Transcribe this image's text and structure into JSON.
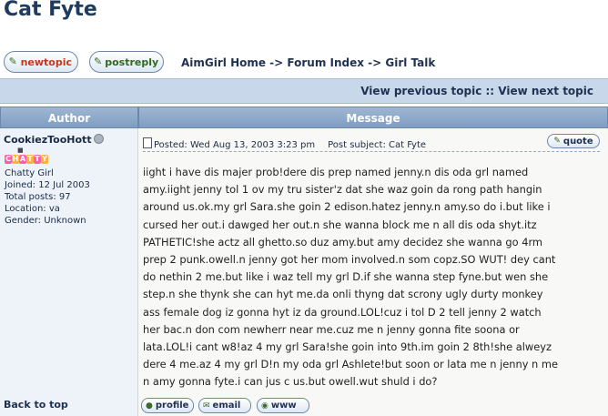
{
  "page": {
    "title": "Cat Fyte"
  },
  "toolbar": {
    "newtopic_label": "newtopic",
    "postreply_label": "postreply"
  },
  "breadcrumb": {
    "text": "AimGirl Home -> Forum Index -> Girl Talk"
  },
  "topic_nav": {
    "text": "View previous topic :: View next topic"
  },
  "table": {
    "author_header": "Author",
    "message_header": "Message"
  },
  "poster": {
    "username": "CookiezTooHott",
    "rank_text": "CHATTY",
    "rank": "Chatty Girl",
    "joined": "Joined: 12 Jul 2003",
    "total_posts": "Total posts: 97",
    "location": "Location: va",
    "gender": "Gender: Unknown"
  },
  "post": {
    "posted": "Posted: Wed Aug 13, 2003 3:23 pm",
    "subject": "Post subject: Cat Fyte",
    "quote_label": "quote",
    "lines": [
      "iight i have dis majer prob!dere dis prep named jenny.n dis oda grl named",
      "amy.iight jenny tol 1 ov my tru sister'z dat she waz goin da rong path hangin",
      "around us.ok.my grl Sara.she goin 2 edison.hatez jenny.n amy.so do i.but like i",
      "cursed her out.i dawged her out.n she wanna block me n all dis oda shyt.itz",
      "PATHETIC!she actz all ghetto.so duz amy.but amy decidez she wanna go 4rm",
      "prep 2 punk.owell.n jenny got her mom involved.n som copz.SO WUT! dey cant",
      "do nethin 2 me.but like i waz tell my grl D.if she wanna step fyne.but wen she",
      "step.n she thynk she can hyt me.da onli thyng dat scrony ugly durty monkey",
      "ass female dog iz gonna hyt iz da ground.LOL!cuz i tol D 2 tell jenny 2 watch",
      "her bac.n don com newherr near me.cuz me n jenny gonna fite soona or",
      "lata.LOL!i cant w8!az 4 my grl Sara!she goin into 9th.im goin 2 8th!she alweyz",
      "dere 4 me.az 4 my grl D!n my oda grl Ashlete!but soon or lata me n jenny n me",
      "n amy gonna fyte.i can jus c us.but owell.wut shuld i do?"
    ]
  },
  "footer": {
    "back_to_top": "Back to top",
    "profile_label": "profile",
    "email_label": "email",
    "www_label": "www"
  }
}
